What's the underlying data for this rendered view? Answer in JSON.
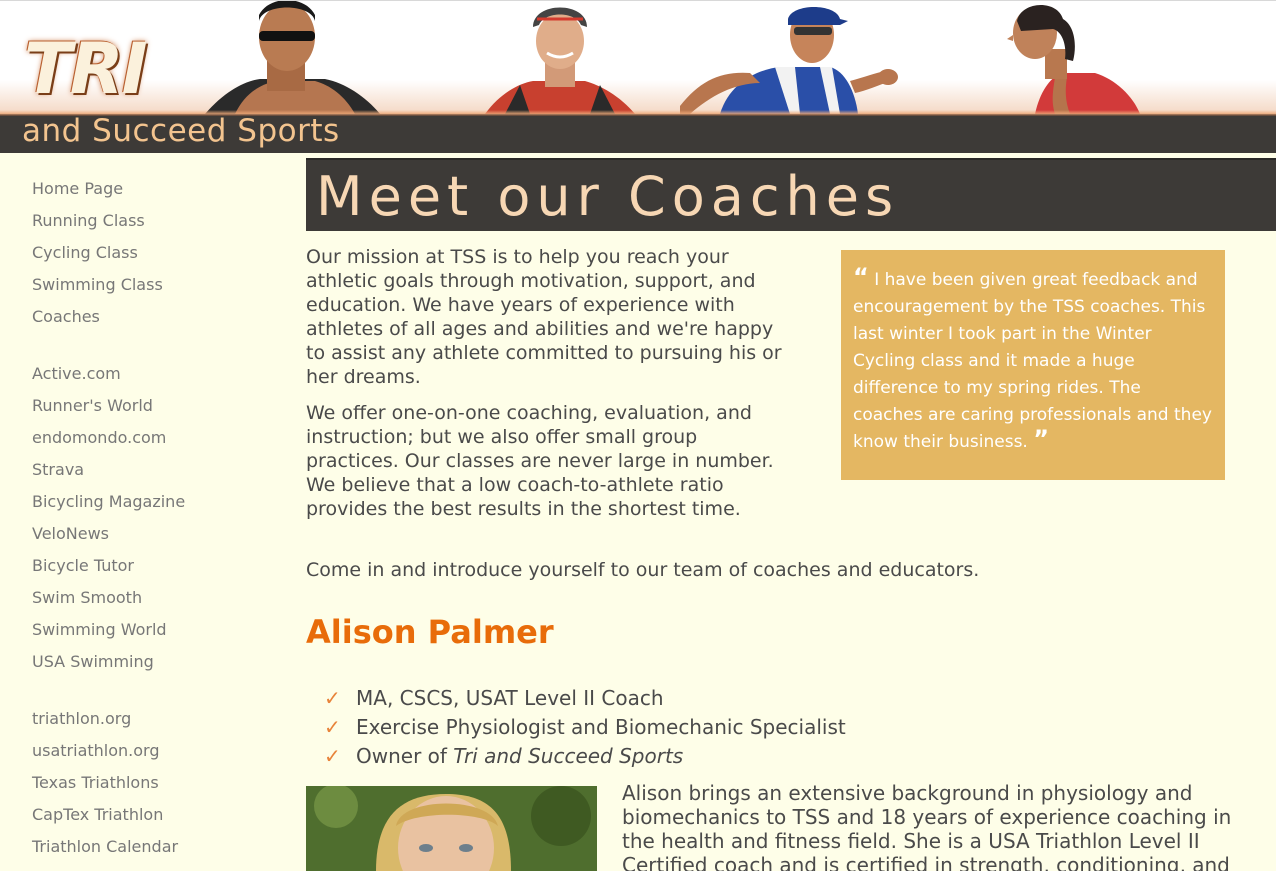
{
  "header": {
    "logo_main": "TRI",
    "logo_sub": "and Succeed Sports"
  },
  "sidebar": {
    "group1": [
      "Home Page",
      "Running Class",
      "Cycling Class",
      "Swimming Class",
      "Coaches"
    ],
    "group2": [
      "Active.com",
      "Runner's World",
      "endomondo.com",
      "Strava",
      "Bicycling Magazine",
      "VeloNews",
      "Bicycle Tutor",
      "Swim Smooth",
      "Swimming World",
      "USA Swimming"
    ],
    "group3": [
      "triathlon.org",
      "usatriathlon.org",
      "Texas Triathlons",
      "CapTex Triathlon",
      "Triathlon Calendar"
    ]
  },
  "main": {
    "title": "Meet our Coaches",
    "p1": "Our mission at TSS is to help you reach your athletic goals through motivation, support, and education. We have years of experience with athletes of all ages and abilities and we're happy to assist any athlete committed to pursuing his or her dreams.",
    "p2": "We offer one-on-one coaching, evaluation, and instruction; but we also offer small group practices. Our classes are never large in number. We believe that a low coach-to-athlete ratio provides the best results in the shortest time.",
    "p3": "Come in and introduce yourself to our team of coaches and educators.",
    "quote_open": "“",
    "quote_text": "I have been given great feedback and encouragement by the TSS coaches. This last winter I took part in the Winter Cycling class and it made a huge difference to my spring rides. The coaches are caring professionals and they know their business.",
    "quote_close": "”",
    "coach_name": "Alison Palmer",
    "credentials": [
      "MA, CSCS, USAT Level II Coach",
      "Exercise Physiologist and Biomechanic Specialist"
    ],
    "credential3_prefix": "Owner of ",
    "credential3_italic": "Tri and Succeed Sports",
    "bio": "Alison brings an extensive background in physiology and biomechanics to TSS and 18 years of experience coaching in the health and fitness field. She is a USA Triathlon Level II Certified coach and is certified in strength, conditioning, and"
  },
  "colors": {
    "background": "#fefee8",
    "header_bar": "#3d3a37",
    "title_text": "#f7d7b4",
    "quote_bg": "#e4b762",
    "coach_name": "#e86c0a",
    "check": "#e8833a"
  },
  "icons": {
    "bullet": "check-icon"
  }
}
